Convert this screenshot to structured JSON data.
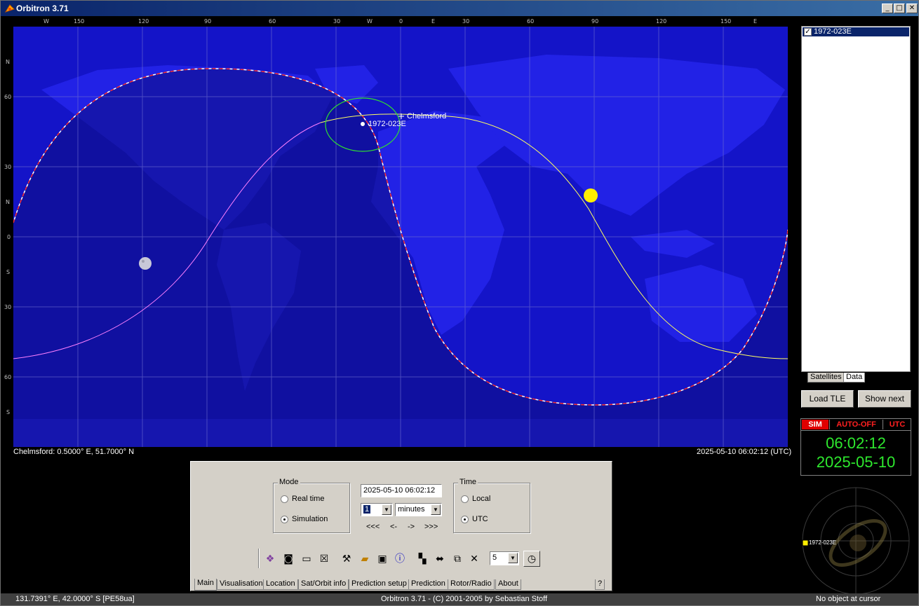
{
  "window": {
    "title": "Orbitron 3.71"
  },
  "map": {
    "top_scale": [
      "W",
      "150",
      "120",
      "90",
      "60",
      "30",
      "W",
      "0",
      "E",
      "30",
      "60",
      "90",
      "120",
      "150",
      "E"
    ],
    "left_scale": [
      "N",
      "60",
      "30",
      "N",
      "0",
      "S",
      "30",
      "60",
      "S"
    ],
    "labels": {
      "satellite": "1972-023E",
      "station": "Chelmsford"
    },
    "station_info": "Chelmsford: 0.5000° E, 51.7000° N",
    "datetime_utc": "2025-05-10 06:02:12 (UTC)"
  },
  "right_panel": {
    "satellites": [
      {
        "name": "1972-023E",
        "checked": true
      }
    ],
    "tabs": [
      "Satellites",
      "Data"
    ],
    "load_tle_label": "Load TLE",
    "show_next_label": "Show next",
    "clock": {
      "sim": "SIM",
      "auto": "AUTO-OFF",
      "utc": "UTC",
      "time": "06:02:12",
      "date": "2025-05-10"
    },
    "radar_label": "1972-023E"
  },
  "control_panel": {
    "mode": {
      "legend": "Mode",
      "options": [
        {
          "label": "Real time",
          "selected": false
        },
        {
          "label": "Simulation",
          "selected": true
        }
      ]
    },
    "datetime_value": "2025-05-10 06:02:12",
    "step_value": "1",
    "step_unit": "minutes",
    "step_buttons": [
      "<<<",
      "<-",
      "->",
      ">>>"
    ],
    "time": {
      "legend": "Time",
      "options": [
        {
          "label": "Local",
          "selected": false
        },
        {
          "label": "UTC",
          "selected": true
        }
      ]
    },
    "speed_value": "5",
    "tabs": [
      "Main",
      "Visualisation",
      "Location",
      "Sat/Orbit info",
      "Prediction setup",
      "Prediction",
      "Rotor/Radio",
      "About"
    ],
    "help_label": "?"
  },
  "statusbar": {
    "cursor": "131.7391° E, 42.0000° S [PE58ua]",
    "copyright": "Orbitron 3.71 - (C) 2001-2005 by Sebastian Stoff",
    "object": "No object at cursor"
  },
  "colors": {
    "ocean": "#1414c8",
    "land": "#2222e6",
    "night": "#0c0c80",
    "sun": "#ffee00",
    "sim_red": "#e00000",
    "clock_green": "#2ee82e"
  }
}
